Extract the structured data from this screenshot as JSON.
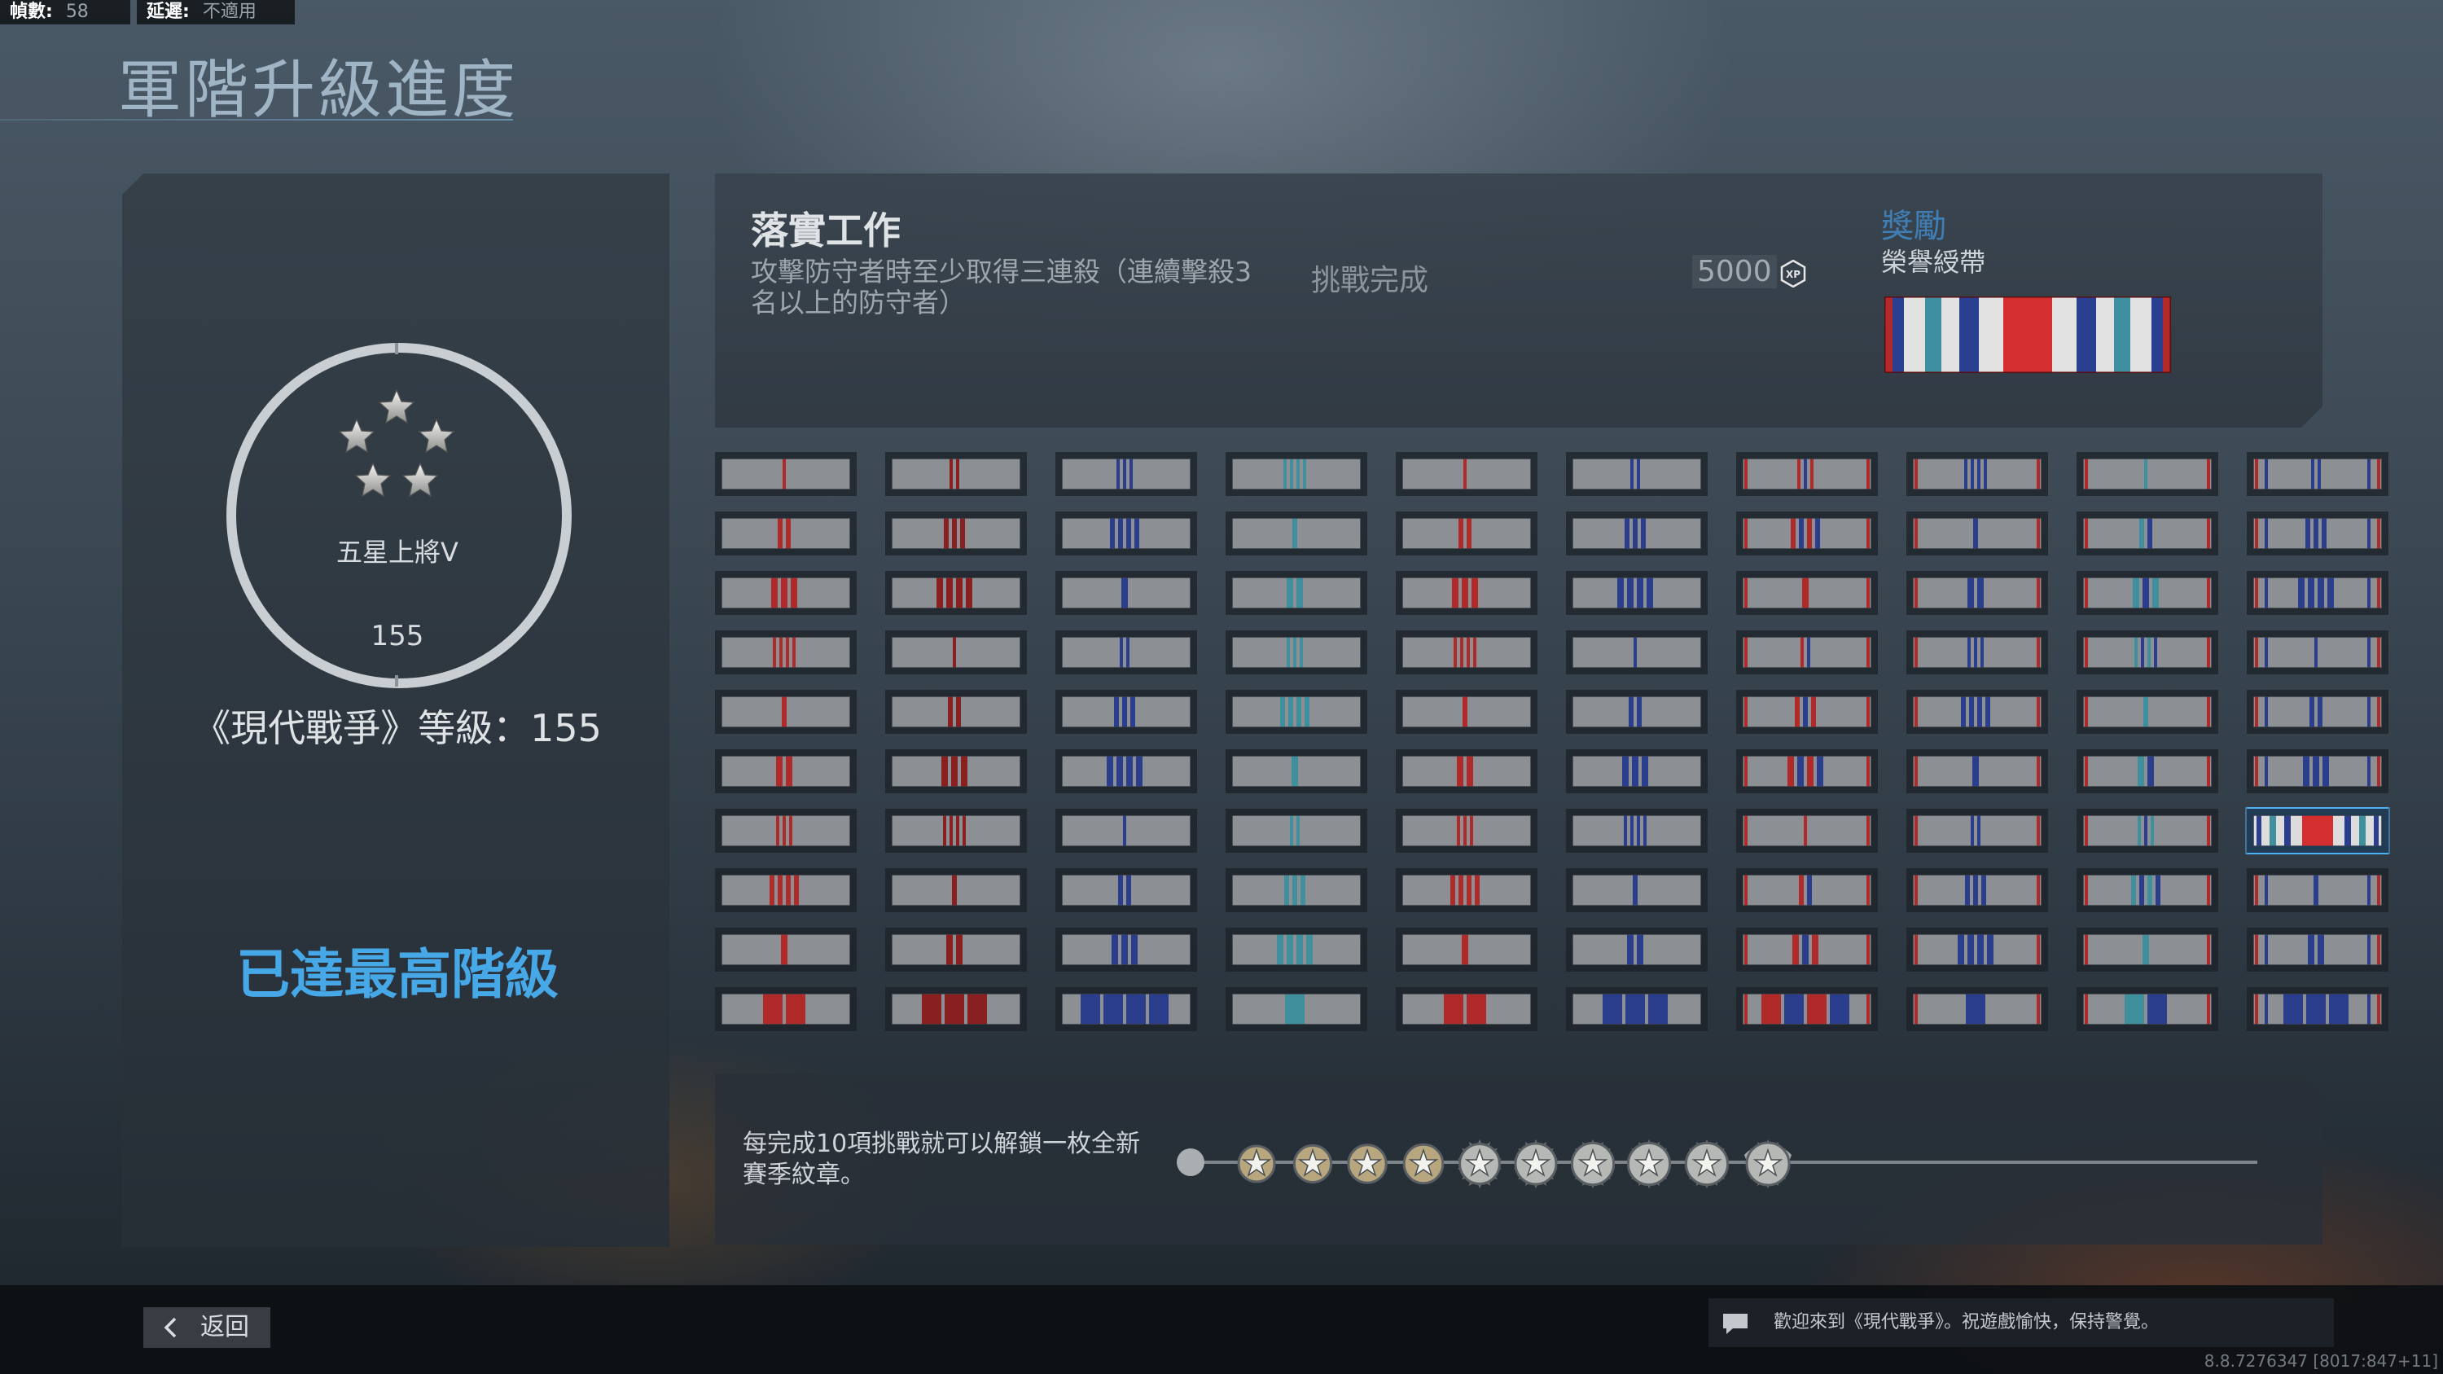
{
  "hud": {
    "fps_label": "幀數:",
    "fps_value": "58",
    "latency_label": "延遲:",
    "latency_value": "不適用"
  },
  "page": {
    "title": "軍階升級進度"
  },
  "rank": {
    "emblem_icon": "five-star-rank-icon",
    "name": "五星上將V",
    "number": "155",
    "mw_level": "《現代戰爭》等級：155",
    "max_rank_text": "已達最高階級"
  },
  "challenge": {
    "title": "落實工作",
    "description": "攻擊防守者時至少取得三連殺（連續擊殺3名以上的防守者）",
    "status": "挑戰完成",
    "xp_amount": "5000",
    "xp_icon": "xp-icon",
    "reward_label": "獎勵",
    "reward_name": "榮譽綬帶"
  },
  "ribbons": {
    "rows": 10,
    "cols": 10,
    "selected_row": 6,
    "selected_col": 9
  },
  "progress": {
    "note": "每完成10項挑戰就可以解鎖一枚全新賽季紋章。",
    "medals": [
      "star-medal-icon",
      "star-medal-icon",
      "star-medal-icon",
      "star-medal-icon",
      "star-medal-icon",
      "star-medal-icon",
      "star-medal-icon",
      "star-medal-icon",
      "star-medal-icon",
      "winged-star-medal-icon"
    ]
  },
  "footer": {
    "back_label": "返回",
    "message": "歡迎來到《現代戰爭》。祝遊戲愉快，保持警覺。",
    "build": "8.8.7276347 [8017:847+11]"
  },
  "colors": {
    "accent_blue": "#47a8e8",
    "reward_blue": "#3f7fb5",
    "ribbon_grey": "#8a8e92"
  }
}
